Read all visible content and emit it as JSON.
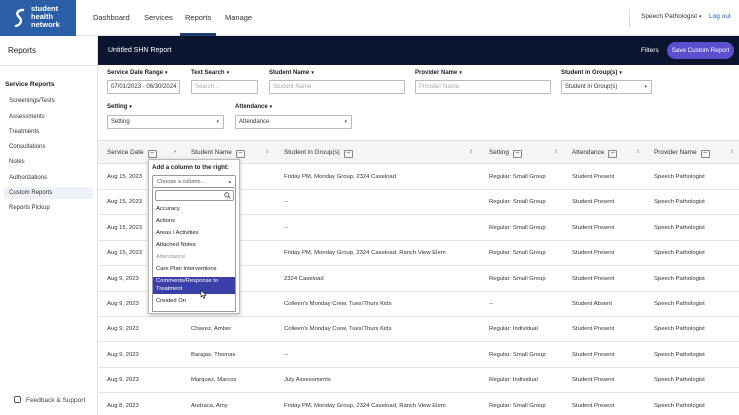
{
  "app": {
    "logo_lines": [
      "student",
      "health",
      "network"
    ],
    "nav": [
      "Dashboard",
      "Services",
      "Reports",
      "Manage"
    ],
    "active_nav": "Reports",
    "role": "Speech Pathologist",
    "logout": "Log out"
  },
  "sidebar": {
    "heading": "Reports",
    "section": "Service Reports",
    "items": [
      "Screenings/Tests",
      "Assessments",
      "Treatments",
      "Consultations",
      "Notes",
      "Authorizations",
      "Custom Reports",
      "Reports Pickup"
    ],
    "active_item": "Custom Reports",
    "feedback": "Feedback & Support"
  },
  "report": {
    "title": "Untitled SHN Report",
    "filters_label": "Filters",
    "save_label": "Save Custom Report"
  },
  "filters": {
    "service_date_range": {
      "label": "Service Date Range",
      "value": "07/01/2023 - 06/30/2024"
    },
    "text_search": {
      "label": "Text Search",
      "placeholder": "Search..."
    },
    "student_name": {
      "label": "Student Name",
      "placeholder": "Student Name"
    },
    "provider_name": {
      "label": "Provider Name",
      "placeholder": "Provider Name"
    },
    "student_group": {
      "label": "Student in Group(s)",
      "value": "Student in Group(s)"
    },
    "setting": {
      "label": "Setting",
      "value": "Setting"
    },
    "attendance": {
      "label": "Attendance",
      "value": "Attendance"
    }
  },
  "table": {
    "columns": [
      "Service Date",
      "Student Name",
      "Student in Group(s)",
      "Setting",
      "Attendance",
      "Provider Name"
    ],
    "rows": [
      [
        "Aug 15, 2023",
        "",
        "Friday PM, Monday Group, 2324 Caseload",
        "Regular: Small Group",
        "Student Present",
        "Speech Pathologist"
      ],
      [
        "Aug 15, 2023",
        "",
        "--",
        "Regular: Small Group",
        "Student Present",
        "Speech Pathologist"
      ],
      [
        "Aug 15, 2023",
        "",
        "--",
        "Regular: Small Group",
        "Student Present",
        "Speech Pathologist"
      ],
      [
        "Aug 15, 2023",
        "",
        "Friday PM, Monday Group, 2324 Caseload, Ranch View Elem",
        "Regular: Small Group",
        "Student Present",
        "Speech Pathologist"
      ],
      [
        "Aug 9, 2023",
        "",
        "2324 Caseload",
        "Regular: Small Group",
        "Student Present",
        "Speech Pathologist"
      ],
      [
        "Aug 9, 2023",
        "",
        "Colleen's Monday Crew, Tues/Thurs Kids",
        "--",
        "Student Absent",
        "Speech Pathologist"
      ],
      [
        "Aug 9, 2023",
        "Chavez, Amber",
        "Colleen's Monday Crew, Tues/Thurs Kids",
        "Regular: Individual",
        "Student Present",
        "Speech Pathologist"
      ],
      [
        "Aug 9, 2023",
        "Barajas, Thomas",
        "--",
        "Regular: Small Group",
        "Student Present",
        "Speech Pathologist"
      ],
      [
        "Aug 9, 2023",
        "Marquez, Marcos",
        "July Assessments",
        "Regular: Individual",
        "Student Present",
        "Speech Pathologist"
      ],
      [
        "Aug 8, 2023",
        "Andraca, Amy",
        "Friday PM, Monday Group, 2324 Caseload, Ranch View Elem",
        "Regular: Small Group",
        "Student Present",
        "Speech Pathologist"
      ]
    ]
  },
  "column_picker": {
    "title": "Add a column to the right:",
    "select_placeholder": "Choose a column...",
    "options": [
      "Accuracy",
      "Actions",
      "Areas / Activities",
      "Attached Notes",
      "Attendance",
      "Care Plan Interventions",
      "Comments/Response to Treatment",
      "Created On"
    ],
    "group_label": "Attendance",
    "selected": "Comments/Response to Treatment"
  },
  "colors": {
    "header_bg": "#0b1530",
    "logo_bg": "#2a5fa8",
    "accent": "#5b4fcf",
    "selected_option": "#3b3fa8"
  }
}
